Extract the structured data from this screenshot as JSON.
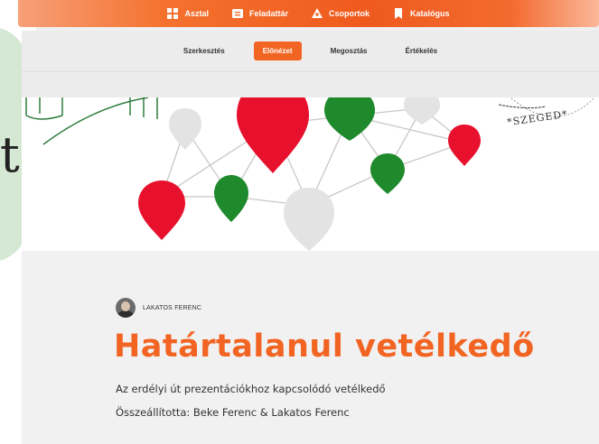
{
  "nav": {
    "items": [
      {
        "label": "Asztal",
        "icon": "dashboard-icon"
      },
      {
        "label": "Feladattár",
        "icon": "task-library-icon"
      },
      {
        "label": "Csoportok",
        "icon": "groups-icon"
      },
      {
        "label": "Katalógus",
        "icon": "bookmark-icon"
      }
    ]
  },
  "tabs": {
    "items": [
      {
        "label": "Szerkesztés",
        "active": false
      },
      {
        "label": "Előnézet",
        "active": true
      },
      {
        "label": "Megosztás",
        "active": false
      },
      {
        "label": "Értékelés",
        "active": false
      }
    ]
  },
  "hero": {
    "stamp_text": "*SZEGED*"
  },
  "quiz": {
    "author": "LAKATOS FERENC",
    "title": "Határtalanul vetélkedő",
    "description": "Az erdélyi út prezentációkhoz kapcsolódó vetélkedő",
    "compiled_by": "Összeállította: Beke Ferenc & Lakatos Ferenc"
  },
  "background": {
    "glyph": "t"
  },
  "colors": {
    "accent": "#f26422",
    "red": "#e8112d",
    "green": "#1f8a2c",
    "grey": "#e3e3e3"
  }
}
